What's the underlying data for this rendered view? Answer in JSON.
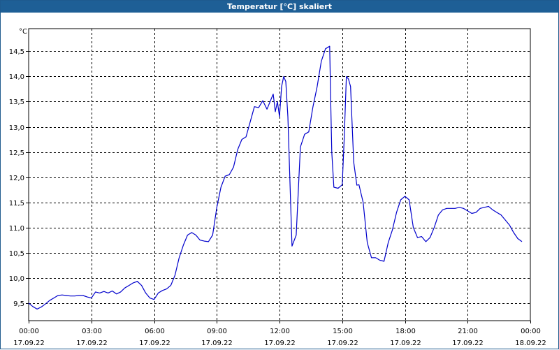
{
  "window": {
    "title": "Temperatur [°C] skaliert"
  },
  "chart_data": {
    "type": "line",
    "title": "Temperatur [°C] skaliert",
    "ylabel": "°C",
    "xlabel": "",
    "ylim": [
      9.15,
      14.95
    ],
    "xlim_hours": [
      0,
      24
    ],
    "grid": true,
    "line_color": "#0000cc",
    "x_ticks": [
      {
        "time": "00:00",
        "date": "17.09.22"
      },
      {
        "time": "03:00",
        "date": "17.09.22"
      },
      {
        "time": "06:00",
        "date": "17.09.22"
      },
      {
        "time": "09:00",
        "date": "17.09.22"
      },
      {
        "time": "12:00",
        "date": "17.09.22"
      },
      {
        "time": "15:00",
        "date": "17.09.22"
      },
      {
        "time": "18:00",
        "date": "17.09.22"
      },
      {
        "time": "21:00",
        "date": "17.09.22"
      },
      {
        "time": "00:00",
        "date": "18.09.22"
      }
    ],
    "y_ticks": [
      "9,5",
      "10,0",
      "10,5",
      "11,0",
      "11,5",
      "12,0",
      "12,5",
      "13,0",
      "13,5",
      "14,0",
      "14,5"
    ],
    "y_tick_values": [
      9.5,
      10.0,
      10.5,
      11.0,
      11.5,
      12.0,
      12.5,
      13.0,
      13.5,
      14.0,
      14.5
    ],
    "series": [
      {
        "x_hours": [
          0,
          0.2,
          0.4,
          0.6,
          0.8,
          1.0,
          1.2,
          1.4,
          1.6,
          1.8,
          2.0,
          2.2,
          2.4,
          2.6,
          2.8,
          3.0,
          3.2,
          3.4,
          3.6,
          3.8,
          4.0,
          4.2,
          4.4,
          4.6,
          4.8,
          5.0,
          5.2,
          5.4,
          5.6,
          5.8,
          6.0,
          6.2,
          6.4,
          6.6,
          6.8,
          7.0,
          7.2,
          7.4,
          7.6,
          7.8,
          8.0,
          8.2,
          8.4,
          8.6,
          8.8,
          9.0,
          9.2,
          9.4,
          9.6,
          9.8,
          10.0,
          10.2,
          10.4,
          10.6,
          10.8,
          11.0,
          11.2,
          11.4,
          11.6,
          11.7,
          11.8,
          11.9,
          12.0,
          12.1,
          12.2,
          12.3,
          12.4,
          12.6,
          12.8,
          13.0,
          13.2,
          13.4,
          13.6,
          13.8,
          14.0,
          14.2,
          14.4,
          14.45,
          14.5,
          14.6,
          14.8,
          15.0,
          15.1,
          15.2,
          15.3,
          15.4,
          15.55,
          15.7,
          15.8,
          16.0,
          16.2,
          16.4,
          16.6,
          16.8,
          17.0,
          17.2,
          17.4,
          17.6,
          17.8,
          18.0,
          18.2,
          18.4,
          18.6,
          18.8,
          19.0,
          19.2,
          19.4,
          19.6,
          19.8,
          20.0,
          20.2,
          20.4,
          20.6,
          20.8,
          21.0,
          21.2,
          21.4,
          21.6,
          21.8,
          22.0,
          22.2,
          22.4,
          22.6,
          22.8,
          23.0,
          23.2,
          23.4,
          23.6
        ],
        "values": [
          9.5,
          9.43,
          9.38,
          9.42,
          9.48,
          9.55,
          9.6,
          9.65,
          9.66,
          9.65,
          9.64,
          9.64,
          9.65,
          9.65,
          9.62,
          9.6,
          9.72,
          9.7,
          9.73,
          9.7,
          9.74,
          9.68,
          9.72,
          9.8,
          9.85,
          9.9,
          9.93,
          9.85,
          9.7,
          9.6,
          9.57,
          9.7,
          9.75,
          9.78,
          9.85,
          10.05,
          10.4,
          10.65,
          10.85,
          10.9,
          10.85,
          10.75,
          10.73,
          10.72,
          10.85,
          11.4,
          11.8,
          12.02,
          12.05,
          12.2,
          12.55,
          12.75,
          12.8,
          13.1,
          13.4,
          13.38,
          13.52,
          13.35,
          13.55,
          13.65,
          13.3,
          13.5,
          13.2,
          13.8,
          14.0,
          13.9,
          13.2,
          10.63,
          10.85,
          12.6,
          12.85,
          12.9,
          13.4,
          13.8,
          14.3,
          14.55,
          14.6,
          13.5,
          12.5,
          11.8,
          11.78,
          11.85,
          12.8,
          14.0,
          13.95,
          13.8,
          12.3,
          11.84,
          11.85,
          11.5,
          10.7,
          10.4,
          10.4,
          10.35,
          10.33,
          10.7,
          10.95,
          11.3,
          11.55,
          11.62,
          11.55,
          11.0,
          10.8,
          10.82,
          10.72,
          10.8,
          11.0,
          11.25,
          11.35,
          11.38,
          11.38,
          11.38,
          11.4,
          11.38,
          11.33,
          11.28,
          11.3,
          11.38,
          11.4,
          11.42,
          11.35,
          11.3,
          11.25,
          11.15,
          11.05,
          10.9,
          10.78,
          10.72
        ]
      }
    ]
  }
}
